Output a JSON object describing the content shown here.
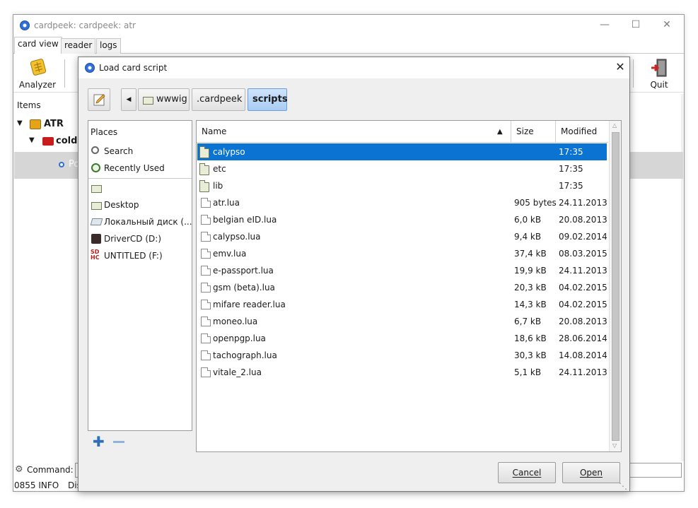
{
  "main_window": {
    "title": "cardpeek: cardpeek: atr",
    "tabs": [
      {
        "label": "card view"
      },
      {
        "label": "reader"
      },
      {
        "label": "logs"
      }
    ],
    "toolbar": {
      "analyzer_label": "Analyzer",
      "quit_label": "Quit"
    },
    "tree": {
      "header": "Items",
      "rows": [
        {
          "label": "ATR"
        },
        {
          "label": "cold"
        },
        {
          "label": "Po"
        }
      ]
    },
    "command_label": "Command:",
    "status": {
      "code": "0855 INFO",
      "text": "Dis"
    }
  },
  "dialog": {
    "title": "Load card script",
    "path": [
      {
        "label": "wwwig"
      },
      {
        "label": ".cardpeek"
      },
      {
        "label": "scripts"
      }
    ],
    "places": {
      "header": "Places",
      "items": [
        {
          "label": "Search",
          "icon": "magnifier-icon"
        },
        {
          "label": "Recently Used",
          "icon": "clock-icon"
        },
        {
          "label": "",
          "icon": "folder-icon"
        },
        {
          "label": "Desktop",
          "icon": "folder-icon"
        },
        {
          "label": "Локальный диск (...",
          "icon": "disk-icon"
        },
        {
          "label": "DriverCD (D:)",
          "icon": "cd-drive-icon"
        },
        {
          "label": "UNTITLED (F:)",
          "icon": "sd-card-icon"
        }
      ]
    },
    "columns": {
      "name": "Name",
      "size": "Size",
      "modified": "Modified"
    },
    "files": [
      {
        "name": "calypso",
        "size": "",
        "modified": "17:35",
        "type": "folder",
        "selected": true
      },
      {
        "name": "etc",
        "size": "",
        "modified": "17:35",
        "type": "folder"
      },
      {
        "name": "lib",
        "size": "",
        "modified": "17:35",
        "type": "folder"
      },
      {
        "name": "atr.lua",
        "size": "905 bytes",
        "modified": "24.11.2013",
        "type": "file"
      },
      {
        "name": "belgian eID.lua",
        "size": "6,0 kB",
        "modified": "20.08.2013",
        "type": "file"
      },
      {
        "name": "calypso.lua",
        "size": "9,4 kB",
        "modified": "09.02.2014",
        "type": "file"
      },
      {
        "name": "emv.lua",
        "size": "37,4 kB",
        "modified": "08.03.2015",
        "type": "file"
      },
      {
        "name": "e-passport.lua",
        "size": "19,9 kB",
        "modified": "24.11.2013",
        "type": "file"
      },
      {
        "name": "gsm (beta).lua",
        "size": "20,3 kB",
        "modified": "04.02.2015",
        "type": "file"
      },
      {
        "name": "mifare reader.lua",
        "size": "14,3 kB",
        "modified": "04.02.2015",
        "type": "file"
      },
      {
        "name": "moneo.lua",
        "size": "6,7 kB",
        "modified": "20.08.2013",
        "type": "file"
      },
      {
        "name": "openpgp.lua",
        "size": "18,6 kB",
        "modified": "28.06.2014",
        "type": "file"
      },
      {
        "name": "tachograph.lua",
        "size": "30,3 kB",
        "modified": "14.08.2014",
        "type": "file"
      },
      {
        "name": "vitale_2.lua",
        "size": "5,1 kB",
        "modified": "24.11.2013",
        "type": "file"
      }
    ],
    "buttons": {
      "cancel": "Cancel",
      "open": "Open"
    },
    "colors": {
      "selection": "#0b73d1",
      "path_active": "#a9ccf3"
    }
  }
}
